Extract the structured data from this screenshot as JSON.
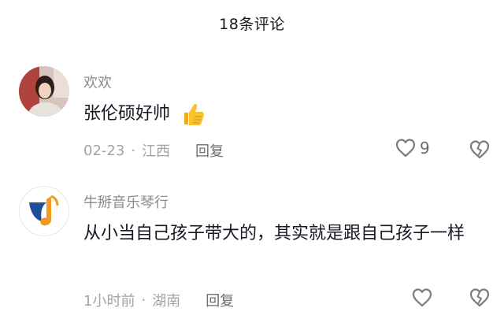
{
  "header": {
    "title": "18条评论"
  },
  "comments": [
    {
      "username": "欢欢",
      "text": "张伦硕好帅",
      "emoji": "thumbs-up-icon",
      "date": "02-23",
      "separator": "·",
      "location": "江西",
      "reply_label": "回复",
      "like_count": "9"
    },
    {
      "username": "牛掰音乐琴行",
      "text": "从小当自己孩子带大的，其实就是跟自己孩子一样",
      "date": "1小时前",
      "separator": "·",
      "location": "湖南",
      "reply_label": "回复",
      "like_count": ""
    }
  ],
  "colors": {
    "primary_text": "#161823",
    "secondary_text": "#8a8b91",
    "logo_blue": "#1f4f9a",
    "logo_orange": "#f39a1e"
  }
}
